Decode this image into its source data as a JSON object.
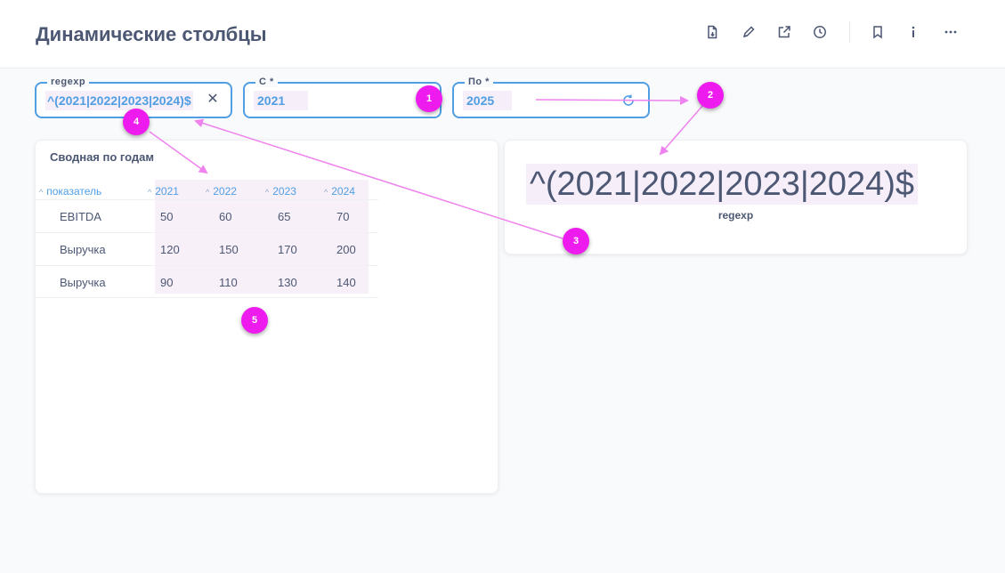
{
  "header": {
    "title": "Динамические столбцы",
    "icons": [
      "document-download-icon",
      "pencil-icon",
      "share-icon",
      "clock-icon",
      "bookmark-icon",
      "info-icon",
      "more-icon"
    ]
  },
  "filters": {
    "regexp": {
      "label": "regexp",
      "value": "^(2021|2022|2023|2024)$",
      "clear": "✕"
    },
    "from": {
      "label": "С *",
      "value": "2021"
    },
    "to": {
      "label": "По *",
      "value": "2025"
    }
  },
  "pivot": {
    "title": "Сводная по годам",
    "columns": [
      "показатель",
      "2021",
      "2022",
      "2023",
      "2024"
    ],
    "rows": [
      [
        "EBITDA",
        "50",
        "60",
        "65",
        "70"
      ],
      [
        "Выручка",
        "120",
        "150",
        "170",
        "200"
      ],
      [
        "Выручка",
        "90",
        "110",
        "130",
        "140"
      ]
    ]
  },
  "scalar": {
    "value": "^(2021|2022|2023|2024)$",
    "label": "regexp"
  },
  "annotations": {
    "color": "#ee1bee",
    "badges": [
      "1",
      "2",
      "3",
      "4",
      "5"
    ]
  },
  "colors": {
    "accent": "#509ee3",
    "text": "#4c5773",
    "highlight": "#f6eef8"
  }
}
